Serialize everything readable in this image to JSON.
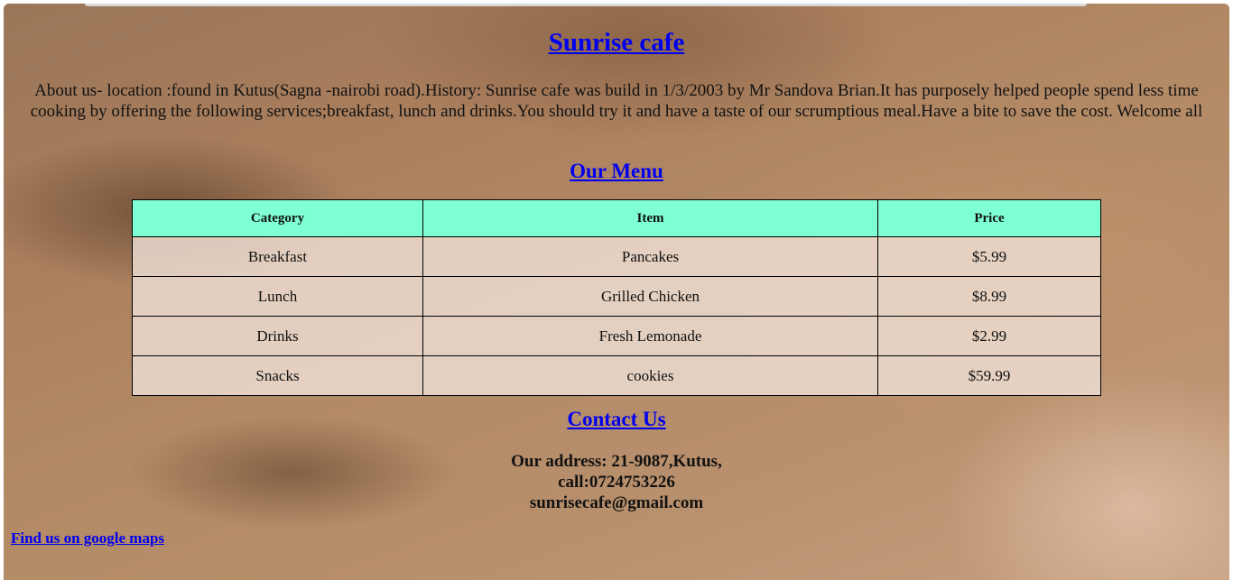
{
  "header": {
    "title": "Sunrise cafe"
  },
  "about": {
    "text": "About us- location :found in Kutus(Sagna -nairobi road).History: Sunrise cafe was build in 1/3/2003 by Mr Sandova Brian.It has purposely helped people spend less time cooking by offering the following services;breakfast, lunch and drinks.You should try it and have a taste of our scrumptious meal.Have a bite to save the cost. Welcome all"
  },
  "menu": {
    "heading": "Our Menu",
    "columns": [
      "Category",
      "Item",
      "Price"
    ],
    "rows": [
      [
        "Breakfast",
        "Pancakes",
        "$5.99"
      ],
      [
        "Lunch",
        "Grilled Chicken",
        "$8.99"
      ],
      [
        "Drinks",
        "Fresh Lemonade",
        "$2.99"
      ],
      [
        "Snacks",
        "cookies",
        "$59.99"
      ]
    ],
    "header_color": "#7fffd4"
  },
  "contact": {
    "heading": "Contact Us",
    "address": "Our address: 21-9087,Kutus,",
    "phone": "call:0724753226",
    "email": "sunrisecafe@gmail.com"
  },
  "maps_link": {
    "label": "Find us on google maps"
  },
  "colors": {
    "link": "#0000ee"
  }
}
